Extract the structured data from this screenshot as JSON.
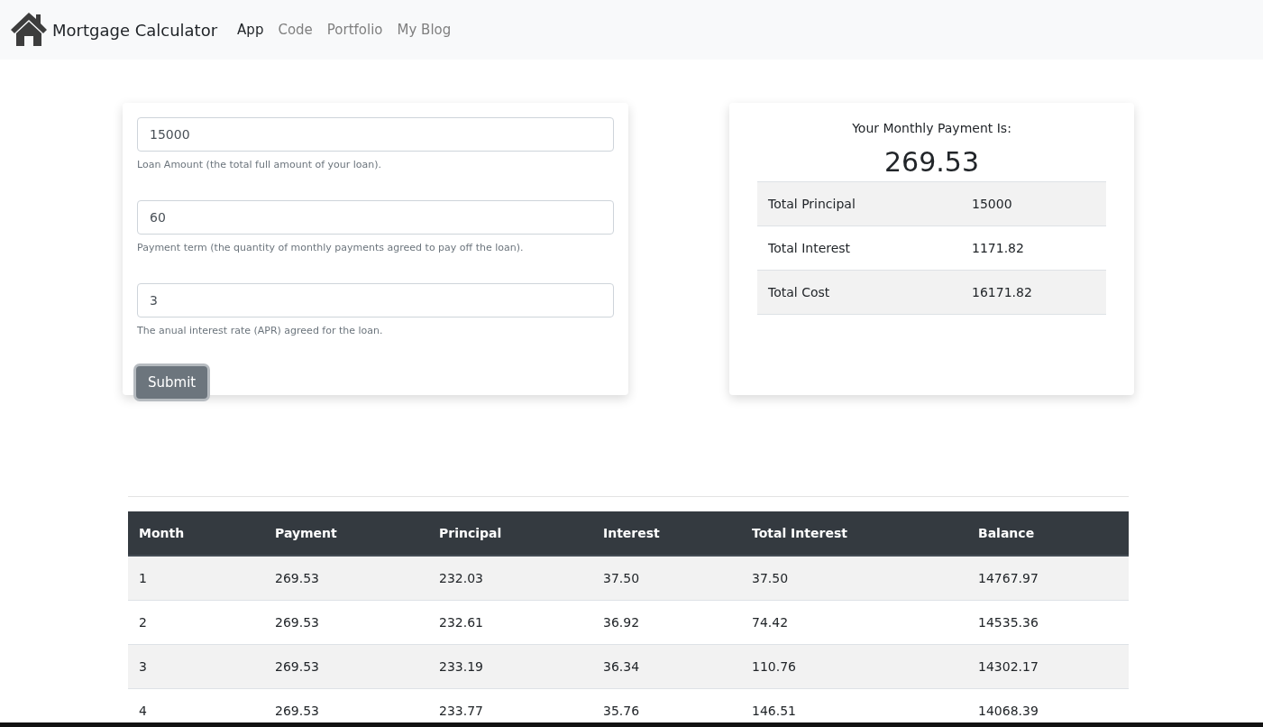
{
  "navbar": {
    "brand": "Mortgage Calculator",
    "links": [
      {
        "label": "App",
        "selected": true
      },
      {
        "label": "Code",
        "selected": false
      },
      {
        "label": "Portfolio",
        "selected": false
      },
      {
        "label": "My Blog",
        "selected": false
      }
    ]
  },
  "form": {
    "fields": [
      {
        "value": "15000",
        "help": "Loan Amount (the total full amount of your loan)."
      },
      {
        "value": "60",
        "help": "Payment term (the quantity of monthly payments agreed to pay off the loan)."
      },
      {
        "value": "3",
        "help": "The anual interest rate (APR) agreed for the loan."
      }
    ],
    "submit": "Submit"
  },
  "result": {
    "title": "Your Monthly Payment Is:",
    "amount": "269.53",
    "rows": [
      {
        "label": "Total Principal",
        "value": "15000"
      },
      {
        "label": "Total Interest",
        "value": "1171.82"
      },
      {
        "label": "Total Cost",
        "value": "16171.82"
      }
    ]
  },
  "schedule": {
    "columns": [
      "Month",
      "Payment",
      "Principal",
      "Interest",
      "Total Interest",
      "Balance"
    ],
    "rows": [
      [
        "1",
        "269.53",
        "232.03",
        "37.50",
        "37.50",
        "14767.97"
      ],
      [
        "2",
        "269.53",
        "232.61",
        "36.92",
        "74.42",
        "14535.36"
      ],
      [
        "3",
        "269.53",
        "233.19",
        "36.34",
        "110.76",
        "14302.17"
      ],
      [
        "4",
        "269.53",
        "233.77",
        "35.76",
        "146.51",
        "14068.39"
      ]
    ]
  }
}
